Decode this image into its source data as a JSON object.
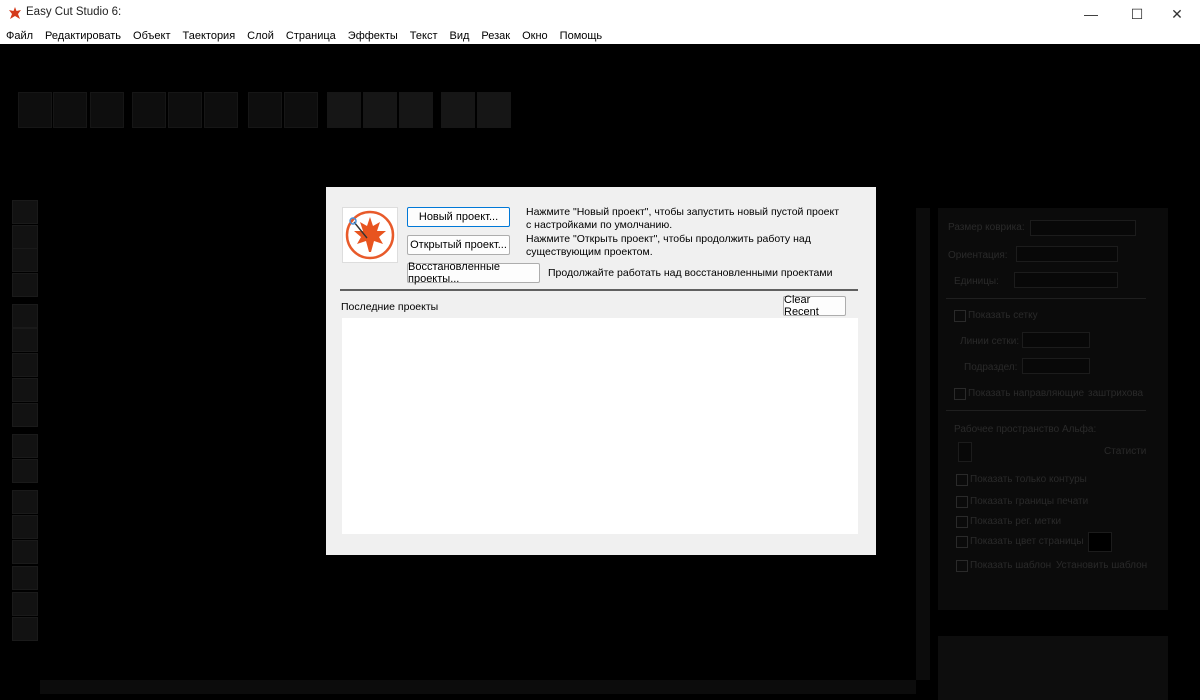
{
  "window": {
    "title": "Easy Cut Studio 6:",
    "minimize": "—",
    "maximize": "☐",
    "close": "✕"
  },
  "menu": [
    "Файл",
    "Редактировать",
    "Объект",
    "Таектория",
    "Слой",
    "Страница",
    "Эффекты",
    "Текст",
    "Вид",
    "Резак",
    "Окно",
    "Помощь"
  ],
  "dialog": {
    "new_project_button": "Новый проект...",
    "new_project_desc": "Нажмите \"Новый проект\", чтобы запустить новый пустой проект с настройками по умолчанию.",
    "open_project_button": "Открытый проект...",
    "open_project_desc": "Нажмите \"Открыть проект\", чтобы продолжить работу над существующим проектом.",
    "recovered_button": "Восстановленные проекты...",
    "recovered_desc": "Продолжайте работать над восстановленными проектами",
    "recent_label": "Последние проекты",
    "clear_recent_button": "Clear Recent",
    "recent_items": []
  },
  "right_panel": {
    "mat_size": "Размер коврика:",
    "orientation": "Ориентация:",
    "units": "Единицы:",
    "show_grid": "Показать сетку",
    "grid_lines": "Линии сетки:",
    "subdivision": "Подраздел:",
    "show_guides": "Показать направляющие",
    "hatching": "заштрихова",
    "alpha_workspace": "Рабочее пространство Альфа:",
    "static": "Статисти",
    "show_outlines": "Показать только контуры",
    "show_print_borders": "Показать границы печати",
    "show_reg_marks": "Показать рег. метки",
    "show_page_color": "Показать цвет страницы",
    "show_template": "Показать шаблон",
    "set_template": "Установить шаблон"
  },
  "colors": {
    "accent": "#0078d7",
    "logo_orange": "#e85a2a"
  }
}
